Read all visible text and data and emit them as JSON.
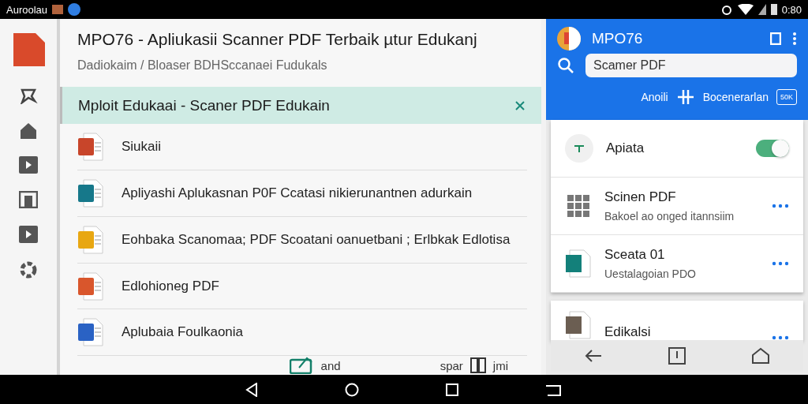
{
  "status_bar": {
    "carrier": "Auroolau",
    "time": "0:80"
  },
  "document": {
    "title": "MPO76 - Apliukasii Scanner PDF Terbaik µtur Edukanj",
    "path": "Dadiokaim / Bloaser BDHSccanaei Fudukals"
  },
  "banner": {
    "text": "Mploit Edukaai - Scaner PDF Edukain"
  },
  "files": [
    {
      "name": "Siukaii",
      "color": "#c8452a"
    },
    {
      "name": "Apliyashi Aplukasnan P0F Ccatasi nikierunantnen adurkain",
      "color": "#16788a"
    },
    {
      "name": "Eohbaka Scanomaa; PDF Scoatani oanuetbani ; Erlbkak Edlotisa",
      "color": "#e8a712"
    },
    {
      "name": "Edlohioneg PDF",
      "color": "#d9562c"
    },
    {
      "name": "Aplubaia Foulkaonia",
      "color": "#2a62c4"
    }
  ],
  "footer": {
    "left_label": "and",
    "right_prefix": "spar",
    "right_suffix": "jmi"
  },
  "app": {
    "name": "MPO76",
    "search_value": "Scamer PDF",
    "filter_label": "Anoili",
    "sort_label": "Bocenerarlan",
    "badge": "50K"
  },
  "cards": [
    {
      "kind": "toggle",
      "title": "Apiata",
      "on": true
    },
    {
      "kind": "item",
      "title": "Scinen PDF",
      "subtitle": "Bakoel ao onged itannsiim"
    },
    {
      "kind": "item",
      "title": "Sceata 01",
      "subtitle": "Uestalagoian PDO"
    }
  ],
  "second_card": {
    "title": "Edikalsi"
  }
}
